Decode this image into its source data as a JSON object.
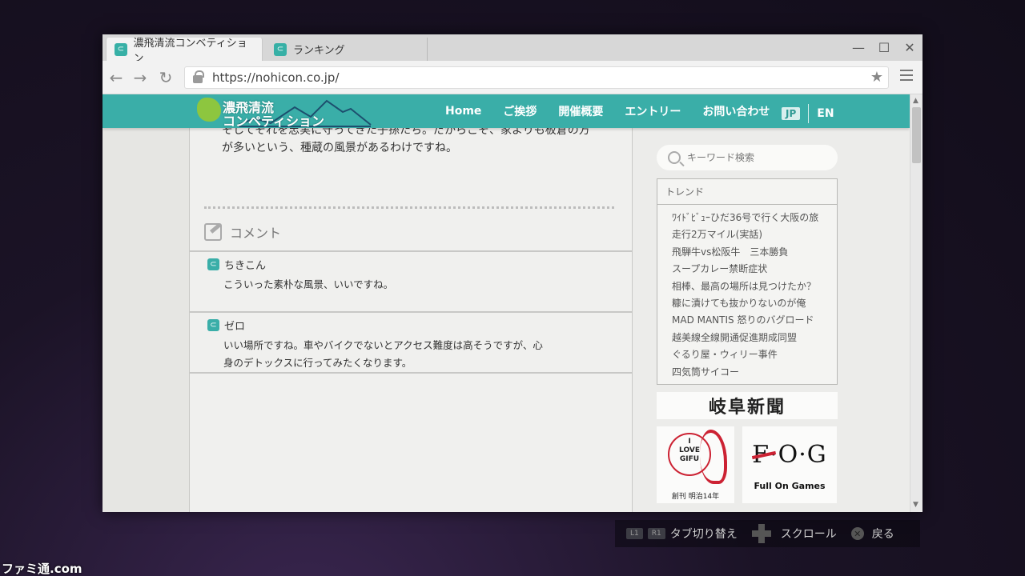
{
  "browser": {
    "tabs": [
      {
        "label": "濃飛清流コンベティション",
        "active": true
      },
      {
        "label": "ランキング",
        "active": false
      }
    ],
    "url": "https://nohicon.co.jp/",
    "window_controls": {
      "minimize": "—",
      "maximize": "☐",
      "close": "✕"
    }
  },
  "site": {
    "logo_line1": "濃飛清流",
    "logo_line2": "コンペティション",
    "nav": [
      "Home",
      "ご挨拶",
      "開催概要",
      "エントリー",
      "お問い合わせ"
    ],
    "lang": {
      "jp": "JP",
      "en": "EN"
    }
  },
  "article": {
    "paragraph": "そしてそれを忠実に守ってきた子孫たち。だからこそ、家よりも板倉の方が多いという、種蔵の風景があるわけですね。"
  },
  "comments": {
    "heading": "コメント",
    "items": [
      {
        "user": "ちきこん",
        "text": "こういった素朴な風景、いいですね。"
      },
      {
        "user": "ゼロ",
        "text": "いい場所ですね。車やバイクでないとアクセス難度は高そうですが、心身のデトックスに行ってみたくなります。"
      }
    ]
  },
  "sidebar": {
    "search_placeholder": "キーワード検索",
    "trend_title": "トレンド",
    "trends": [
      "ﾜｲﾄﾞﾋﾞｭｰひだ36号で行く大阪の旅",
      "走行2万マイル(実話)",
      "飛騨牛vs松阪牛　三本勝負",
      "スープカレー禁断症状",
      "相棒、最高の場所は見つけたか？",
      "糠に漬けても抜かりないのが俺",
      "MAD MANTIS 怒りのバグロード",
      "越美線全線開通促進期成同盟",
      "ぐるり屋・ウィリー事件",
      "四気筒サイコー"
    ],
    "ad_newspaper": "岐阜新聞",
    "ad_gifu_lines": [
      "I",
      "LOVE",
      "GIFU"
    ],
    "ad_gifu_since": "創刊 明治14年",
    "ad_fog": "F·O·G",
    "ad_fog_sub": "Full On Games"
  },
  "hints": {
    "l1": "L1",
    "r1": "R1",
    "tab_switch": "タブ切り替え",
    "scroll": "スクロール",
    "back": "戻る"
  },
  "watermark": "ファミ通.com",
  "colors": {
    "accent": "#3aaea8",
    "ad_red": "#cc2233"
  }
}
